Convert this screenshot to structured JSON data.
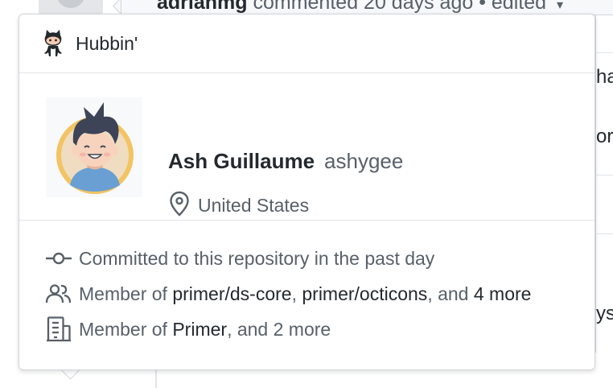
{
  "background": {
    "comment_author": "adrianmg",
    "comment_meta": " commented 20 days ago • edited",
    "edit_caret": "▾",
    "peek_lines": [
      "ha",
      "or",
      "ys"
    ]
  },
  "hovercard": {
    "app_name": "Hubbin'",
    "app_icon": "octocat-icon",
    "user": {
      "full_name": "Ash Guillaume",
      "login": "ashygee",
      "location": "United States"
    },
    "context": {
      "committed": "Committed to this repository in the past day",
      "teams": {
        "prefix": "Member of ",
        "team1": "primer/ds-core",
        "sep": ", ",
        "team2": "primer/octicons",
        "and": ", and ",
        "more": "4 more"
      },
      "org": {
        "prefix": "Member of ",
        "org1": "Primer",
        "suffix": ", and 2 more"
      }
    }
  },
  "colors": {
    "border": "#d1d5da",
    "text_primary": "#24292e",
    "text_secondary": "#586069",
    "avatar_ring": "#f2c462"
  }
}
